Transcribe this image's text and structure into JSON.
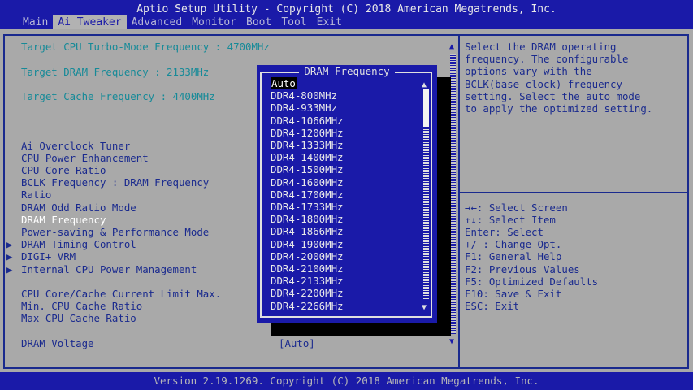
{
  "title": "Aptio Setup Utility - Copyright (C) 2018 American Megatrends, Inc.",
  "tabs": [
    "Main",
    "Ai Tweaker",
    "Advanced",
    "Monitor",
    "Boot",
    "Tool",
    "Exit"
  ],
  "active_tab": "Ai Tweaker",
  "info_lines": [
    "Target CPU Turbo-Mode Frequency : 4700MHz",
    "Target DRAM Frequency : 2133MHz",
    "Target Cache Frequency : 4400MHz"
  ],
  "settings": {
    "ai_overclock_tuner": "Ai Overclock Tuner",
    "cpu_power_enhancement": "CPU Power Enhancement",
    "cpu_core_ratio": "CPU Core Ratio",
    "bclk_line1": "BCLK Frequency : DRAM Frequency",
    "bclk_line2": "Ratio",
    "dram_odd_ratio": "DRAM Odd Ratio Mode",
    "dram_frequency": "DRAM Frequency",
    "power_saving": "Power-saving & Performance Mode",
    "dram_timing": "DRAM Timing Control",
    "digi_vrm": "DIGI+ VRM",
    "internal_cpu_power": "Internal CPU Power Management",
    "cpu_cache_limit": "CPU Core/Cache Current Limit Max.",
    "min_cache_ratio": "Min. CPU Cache Ratio",
    "max_cache_ratio": "Max CPU Cache Ratio",
    "dram_voltage": "DRAM Voltage",
    "dram_voltage_value": "[Auto]"
  },
  "submenu_arrow": "▶",
  "popup": {
    "title": "DRAM Frequency",
    "options": [
      "Auto",
      "DDR4-800MHz",
      "DDR4-933MHz",
      "DDR4-1066MHz",
      "DDR4-1200MHz",
      "DDR4-1333MHz",
      "DDR4-1400MHz",
      "DDR4-1500MHz",
      "DDR4-1600MHz",
      "DDR4-1700MHz",
      "DDR4-1733MHz",
      "DDR4-1800MHz",
      "DDR4-1866MHz",
      "DDR4-1900MHz",
      "DDR4-2000MHz",
      "DDR4-2100MHz",
      "DDR4-2133MHz",
      "DDR4-2200MHz",
      "DDR4-2266MHz"
    ],
    "selected": "Auto"
  },
  "help_text": [
    "Select the DRAM operating",
    "frequency. The configurable",
    "options vary with the",
    "BCLK(base clock) frequency",
    "setting. Select the auto mode",
    "to apply the optimized setting."
  ],
  "key_help": [
    "→←: Select Screen",
    "↑↓: Select Item",
    "Enter: Select",
    "+/-: Change Opt.",
    "F1: General Help",
    "F2: Previous Values",
    "F5: Optimized Defaults",
    "F10: Save & Exit",
    "ESC: Exit"
  ],
  "footer": "Version 2.19.1269. Copyright (C) 2018 American Megatrends, Inc.",
  "colors": {
    "bios_blue": "#1a1aa8",
    "panel_grey": "#a9a9a9",
    "info_cyan": "#168a98",
    "text_blue": "#1a2a8e",
    "highlight_white": "#ffffff"
  },
  "icons": {
    "scroll_up": "arrow-up-icon",
    "scroll_down": "arrow-down-icon",
    "submenu": "triangle-right-icon"
  }
}
